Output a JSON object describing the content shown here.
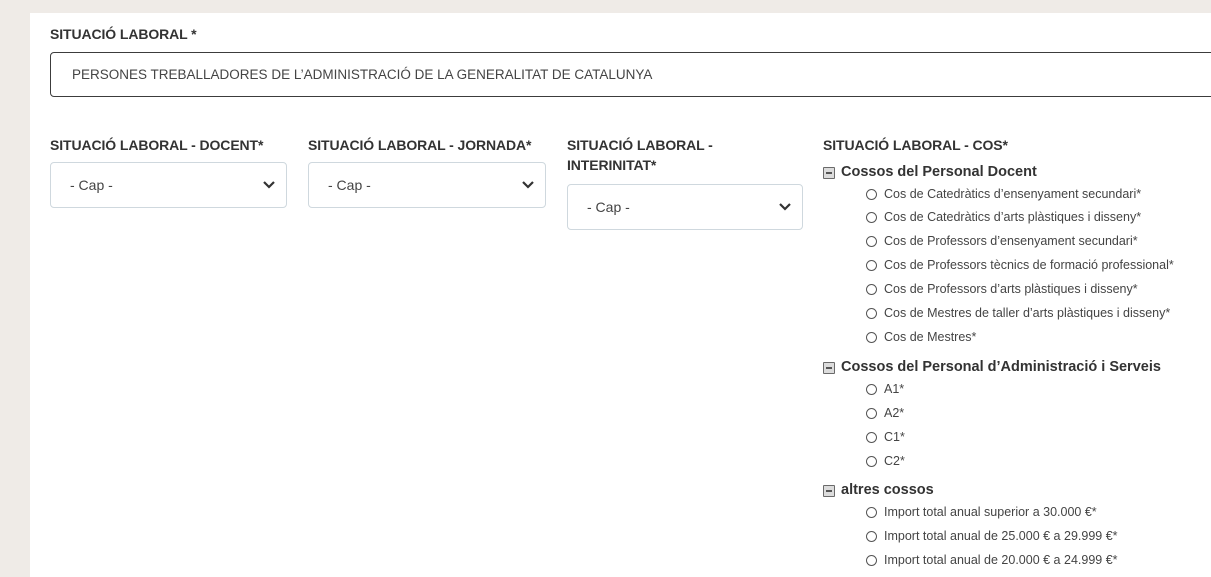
{
  "situacio_laboral": {
    "label": "SITUACIÓ LABORAL *",
    "value": "PERSONES TREBALLADORES DE L’ADMINISTRACIÓ DE LA GENERALITAT DE CATALUNYA"
  },
  "docent": {
    "label": "SITUACIÓ LABORAL - DOCENT*",
    "value": "- Cap -"
  },
  "jornada": {
    "label": "SITUACIÓ LABORAL - JORNADA*",
    "value": "- Cap -"
  },
  "interinitat": {
    "label_line1": "SITUACIÓ LABORAL -",
    "label_line2": "INTERINITAT*",
    "value": "- Cap -"
  },
  "cos": {
    "label": "SITUACIÓ LABORAL - COS*",
    "groups": [
      {
        "title": "Cossos del Personal Docent",
        "options": [
          "Cos de Catedràtics d’ensenyament secundari*",
          "Cos de Catedràtics d’arts plàstiques i disseny*",
          "Cos de Professors d’ensenyament secundari*",
          "Cos de Professors tècnics de formació professional*",
          "Cos de Professors d’arts plàstiques i disseny*",
          "Cos de Mestres de taller d’arts plàstiques i disseny*",
          "Cos de Mestres*"
        ]
      },
      {
        "title": "Cossos del Personal d’Administració i Serveis",
        "options": [
          "A1*",
          "A2*",
          "C1*",
          "C2*"
        ]
      },
      {
        "title": "altres cossos",
        "options": [
          "Import total anual superior a 30.000 €*",
          "Import total anual de 25.000 € a 29.999 €*",
          "Import total anual de 20.000 € a 24.999 €*"
        ]
      }
    ]
  },
  "icons": {
    "select_arrow": "chevron-down-icon",
    "group_toggle": "collapse-box-icon",
    "option_radio": "radio-icon"
  },
  "colors": {
    "background": "#efebe7",
    "panel": "#ffffff",
    "field_border": "#3c3c3c",
    "select_border": "#cfd8de"
  }
}
